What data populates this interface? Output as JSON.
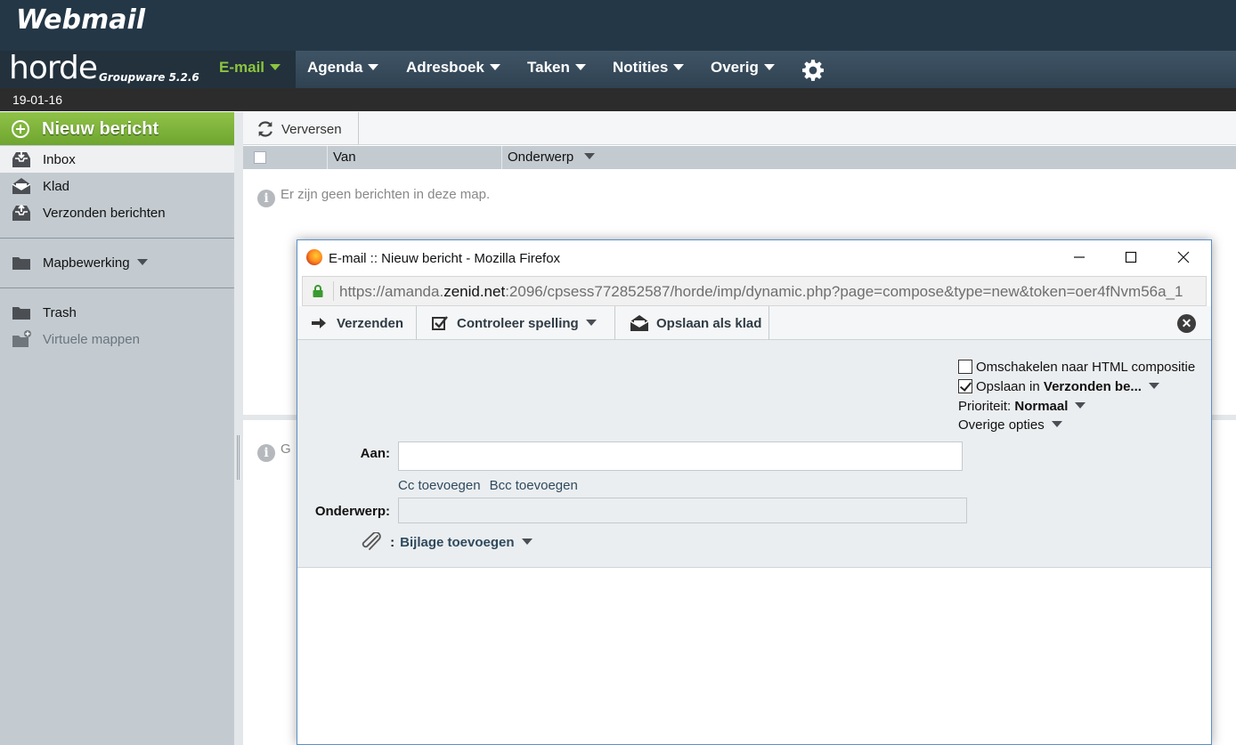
{
  "brand": {
    "title": "Webmail",
    "logo_word": "horde",
    "logo_sub": "Groupware 5.2.6"
  },
  "nav": {
    "items": [
      {
        "label": "E-mail"
      },
      {
        "label": "Agenda"
      },
      {
        "label": "Adresboek"
      },
      {
        "label": "Taken"
      },
      {
        "label": "Notities"
      },
      {
        "label": "Overig"
      }
    ],
    "settings_icon": "gear-icon"
  },
  "date": "19-01-16",
  "sidebar": {
    "new_message": "Nieuw bericht",
    "folders": [
      {
        "label": "Inbox",
        "icon": "inbox-icon"
      },
      {
        "label": "Klad",
        "icon": "drafts-icon"
      },
      {
        "label": "Verzonden berichten",
        "icon": "sent-icon"
      }
    ],
    "folder_actions": "Mapbewerking",
    "trash": "Trash",
    "virtual_folders": "Virtuele mappen"
  },
  "mail_list": {
    "refresh_label": "Verversen",
    "columns": [
      "Van",
      "Onderwerp"
    ],
    "empty_message": "Er zijn geen berichten in deze map.",
    "preview_text": "G"
  },
  "popup": {
    "window_title": "E-mail :: Nieuw bericht - Mozilla Firefox",
    "url_prefix": "https://amanda.",
    "url_domain": "zenid.net",
    "url_rest": ":2096/cpsess772852587/horde/imp/dynamic.php?page=compose&type=new&token=oer4fNvm56a_1",
    "toolbar": {
      "send": "Verzenden",
      "spell": "Controleer spelling",
      "save_draft": "Opslaan als klad"
    },
    "options": {
      "html_toggle": "Omschakelen naar HTML compositie",
      "save_in_prefix": "Opslaan in",
      "save_in_folder": "Verzonden be...",
      "priority_label": "Prioriteit:",
      "priority_value": "Normaal",
      "other_options": "Overige opties"
    },
    "fields": {
      "to_label": "Aan:",
      "to_value": "",
      "cc_link": "Cc toevoegen",
      "bcc_link": "Bcc toevoegen",
      "subject_label": "Onderwerp:",
      "subject_value": "",
      "attach_colon": ":",
      "attach_label": "Bijlage toevoegen"
    }
  }
}
